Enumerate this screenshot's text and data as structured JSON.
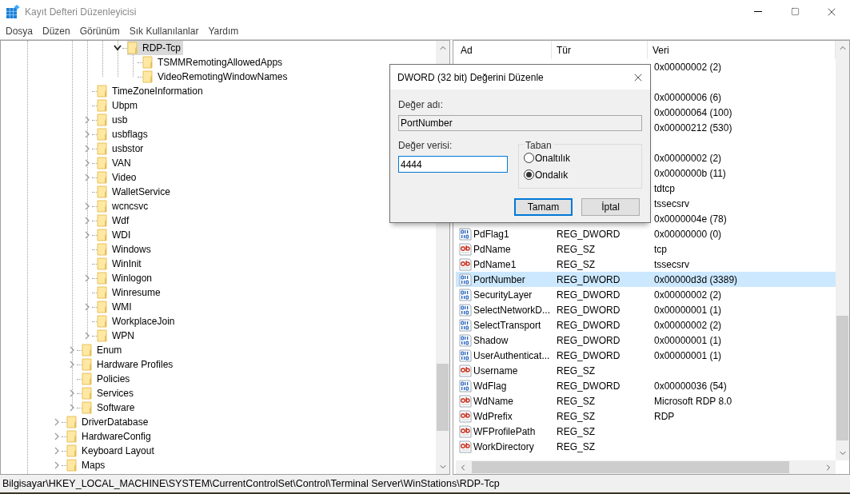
{
  "window": {
    "title": "Kayıt Defteri Düzenleyicisi"
  },
  "menu": [
    "Dosya",
    "Düzen",
    "Görünüm",
    "Sık Kullanılanlar",
    "Yardım"
  ],
  "tree": [
    {
      "kind": "offscreen",
      "children": [
        {
          "kind": "offscreen",
          "children": [
            {
              "kind": "offscreen",
              "children": [
                {
                  "kind": "offscreen",
                  "children": [
                    {
                      "kind": "folder",
                      "label": "RDP-Tcp",
                      "expanded": true,
                      "selected": true,
                      "children": [
                        {
                          "kind": "folder",
                          "label": "TSMMRemotingAllowedApps",
                          "selected": false
                        },
                        {
                          "kind": "folder",
                          "label": "VideoRemotingWindowNames",
                          "selected": false
                        }
                      ]
                    }
                  ]
                }
              ]
            },
            {
              "kind": "folder",
              "label": "TimeZoneInformation",
              "selected": false
            },
            {
              "kind": "folder",
              "label": "Ubpm",
              "selected": false
            },
            {
              "kind": "folder",
              "label": "usb",
              "expanded": false,
              "selected": false
            },
            {
              "kind": "folder",
              "label": "usbflags",
              "expanded": false,
              "selected": false
            },
            {
              "kind": "folder",
              "label": "usbstor",
              "expanded": false,
              "selected": false
            },
            {
              "kind": "folder",
              "label": "VAN",
              "expanded": false,
              "selected": false
            },
            {
              "kind": "folder",
              "label": "Video",
              "expanded": false,
              "selected": false
            },
            {
              "kind": "folder",
              "label": "WalletService",
              "selected": false
            },
            {
              "kind": "folder",
              "label": "wcncsvc",
              "expanded": false,
              "selected": false
            },
            {
              "kind": "folder",
              "label": "Wdf",
              "expanded": false,
              "selected": false
            },
            {
              "kind": "folder",
              "label": "WDI",
              "expanded": false,
              "selected": false
            },
            {
              "kind": "folder",
              "label": "Windows",
              "selected": false
            },
            {
              "kind": "folder",
              "label": "WinInit",
              "selected": false
            },
            {
              "kind": "folder",
              "label": "Winlogon",
              "expanded": false,
              "selected": false
            },
            {
              "kind": "folder",
              "label": "Winresume",
              "selected": false
            },
            {
              "kind": "folder",
              "label": "WMI",
              "expanded": false,
              "selected": false
            },
            {
              "kind": "folder",
              "label": "WorkplaceJoin",
              "selected": false
            },
            {
              "kind": "folder",
              "label": "WPN",
              "expanded": false,
              "selected": false
            }
          ]
        },
        {
          "kind": "folder",
          "label": "Enum",
          "expanded": false,
          "selected": false
        },
        {
          "kind": "folder",
          "label": "Hardware Profiles",
          "expanded": false,
          "selected": false
        },
        {
          "kind": "folder",
          "label": "Policies",
          "selected": false
        },
        {
          "kind": "folder",
          "label": "Services",
          "expanded": false,
          "selected": false
        },
        {
          "kind": "folder",
          "label": "Software",
          "expanded": false,
          "selected": false
        }
      ]
    },
    {
      "kind": "folder",
      "label": "DriverDatabase",
      "expanded": false,
      "selected": false
    },
    {
      "kind": "folder",
      "label": "HardwareConfig",
      "expanded": false,
      "selected": false
    },
    {
      "kind": "folder",
      "label": "Keyboard Layout",
      "expanded": false,
      "selected": false
    },
    {
      "kind": "folder",
      "label": "Maps",
      "expanded": false,
      "selected": false
    }
  ],
  "list": {
    "columns": [
      "Ad",
      "Tür",
      "Veri"
    ],
    "rows": [
      {
        "kind": "covered",
        "data": "0x00000002 (2)",
        "selected": false
      },
      {
        "kind": "covered",
        "selected": false
      },
      {
        "kind": "covered",
        "data": "0x00000006 (6)",
        "selected": false
      },
      {
        "kind": "covered",
        "data": "0x00000064 (100)",
        "selected": false
      },
      {
        "kind": "covered",
        "data": "0x00000212 (530)",
        "selected": false
      },
      {
        "kind": "covered",
        "selected": false
      },
      {
        "kind": "covered",
        "data": "0x00000002 (2)",
        "selected": false
      },
      {
        "kind": "covered",
        "data": "0x0000000b (11)",
        "selected": false
      },
      {
        "kind": "covered",
        "data": "tdtcp",
        "selected": false
      },
      {
        "kind": "covered",
        "data": "tssecsrv",
        "selected": false
      },
      {
        "kind": "covered",
        "data": "0x0000004e (78)",
        "selected": false
      },
      {
        "kind": "dword",
        "name": "PdFlag1",
        "type": "REG_DWORD",
        "data": "0x00000000 (0)",
        "selected": false
      },
      {
        "kind": "sz",
        "name": "PdName",
        "type": "REG_SZ",
        "data": "tcp",
        "selected": false
      },
      {
        "kind": "sz",
        "name": "PdName1",
        "type": "REG_SZ",
        "data": "tssecsrv",
        "selected": false
      },
      {
        "kind": "dword",
        "name": "PortNumber",
        "type": "REG_DWORD",
        "data": "0x00000d3d (3389)",
        "selected": true
      },
      {
        "kind": "dword",
        "name": "SecurityLayer",
        "type": "REG_DWORD",
        "data": "0x00000002 (2)",
        "selected": false
      },
      {
        "kind": "dword",
        "name": "SelectNetworkD...",
        "type": "REG_DWORD",
        "data": "0x00000001 (1)",
        "selected": false
      },
      {
        "kind": "dword",
        "name": "SelectTransport",
        "type": "REG_DWORD",
        "data": "0x00000002 (2)",
        "selected": false
      },
      {
        "kind": "dword",
        "name": "Shadow",
        "type": "REG_DWORD",
        "data": "0x00000001 (1)",
        "selected": false
      },
      {
        "kind": "dword",
        "name": "UserAuthenticat...",
        "type": "REG_DWORD",
        "data": "0x00000001 (1)",
        "selected": false
      },
      {
        "kind": "sz",
        "name": "Username",
        "type": "REG_SZ",
        "selected": false
      },
      {
        "kind": "dword",
        "name": "WdFlag",
        "type": "REG_DWORD",
        "data": "0x00000036 (54)",
        "selected": false
      },
      {
        "kind": "sz",
        "name": "WdName",
        "type": "REG_SZ",
        "data": "Microsoft RDP 8.0",
        "selected": false
      },
      {
        "kind": "sz",
        "name": "WdPrefix",
        "type": "REG_SZ",
        "data": "RDP",
        "selected": false
      },
      {
        "kind": "sz",
        "name": "WFProfilePath",
        "type": "REG_SZ",
        "selected": false
      },
      {
        "kind": "sz",
        "name": "WorkDirectory",
        "type": "REG_SZ",
        "selected": false
      }
    ]
  },
  "dialog": {
    "title": "DWORD (32 bit) Değerini Düzenle",
    "name_label": "Değer adı:",
    "name_value": "PortNumber",
    "data_label": "Değer verisi:",
    "data_value": "4444",
    "base_group": {
      "title": "Taban",
      "options": [
        {
          "label": "Onaltılık",
          "selected": false
        },
        {
          "label": "Ondalık",
          "selected": true
        }
      ]
    },
    "buttons": [
      {
        "label": "Tamam",
        "default": true
      },
      {
        "label": "İptal",
        "default": false
      }
    ]
  },
  "status_bar": "Bilgisayar\\HKEY_LOCAL_MACHINE\\SYSTEM\\CurrentControlSet\\Control\\Terminal Server\\WinStations\\RDP-Tcp"
}
